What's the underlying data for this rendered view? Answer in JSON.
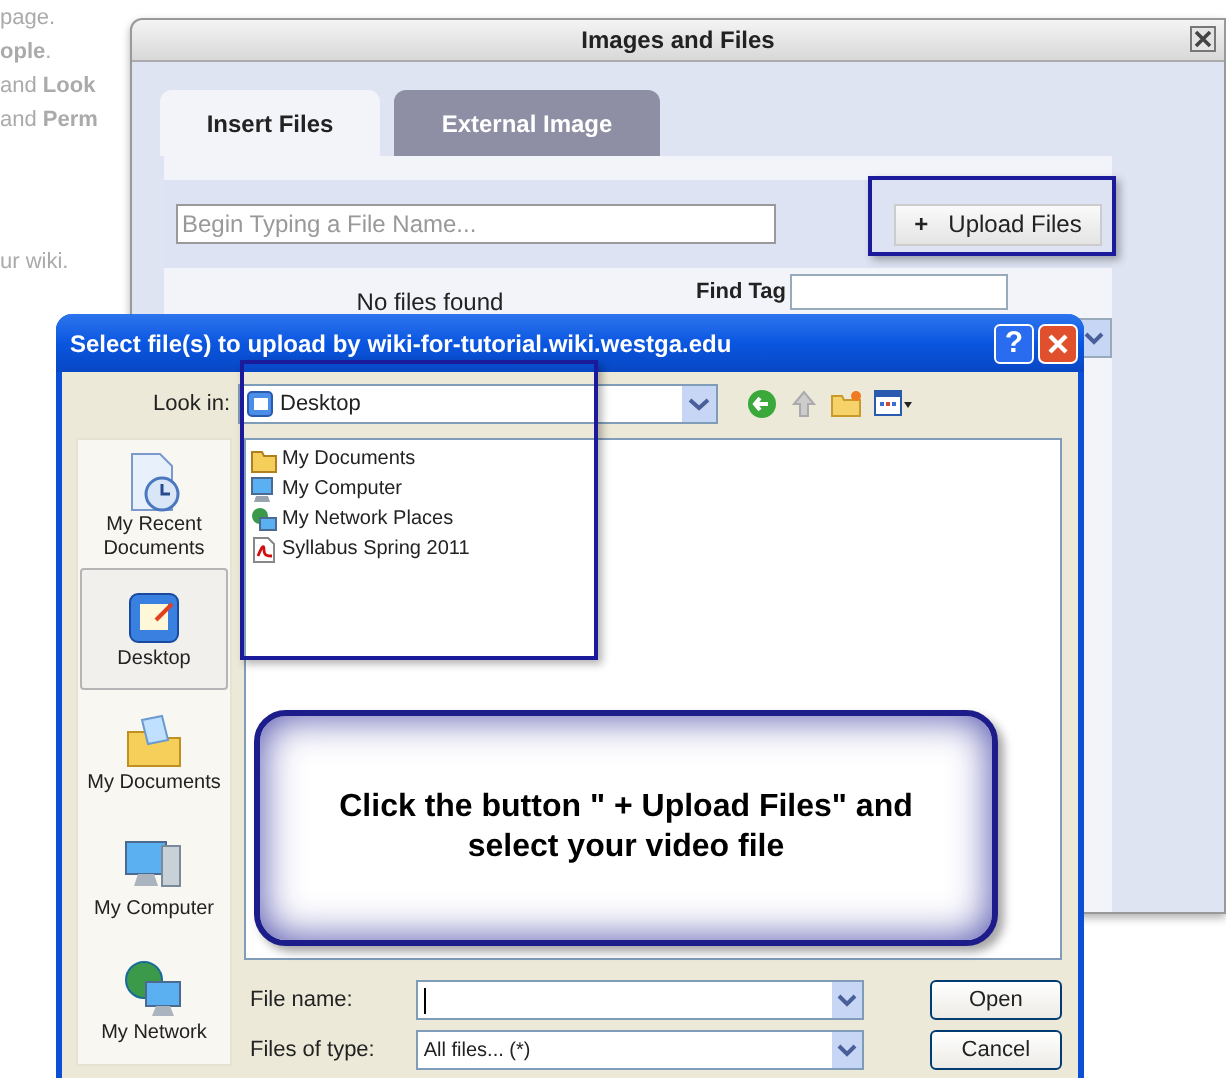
{
  "background_page": {
    "lines": [
      "page.",
      "**ople**.",
      "and **Look**",
      "and **Perm**",
      "ur wiki."
    ]
  },
  "images_dialog": {
    "title": "Images and Files",
    "tabs": [
      {
        "label": "Insert Files",
        "selected": true
      },
      {
        "label": "External Image",
        "selected": false
      }
    ],
    "search": {
      "placeholder": "Begin Typing a File Name..."
    },
    "upload_button": {
      "icon": "+",
      "label": "Upload Files"
    },
    "empty_message": "No files found",
    "find_tag_label": "Find Tag"
  },
  "file_dialog": {
    "title": "Select file(s) to upload by wiki-for-tutorial.wiki.westga.edu",
    "help_button": "?",
    "look_in_label": "Look in:",
    "look_in_value": "Desktop",
    "places": [
      {
        "label": "My Recent Documents",
        "kind": "recent",
        "selected": false
      },
      {
        "label": "Desktop",
        "kind": "desktop",
        "selected": true
      },
      {
        "label": "My Documents",
        "kind": "documents",
        "selected": false
      },
      {
        "label": "My Computer",
        "kind": "computer",
        "selected": false
      },
      {
        "label": "My Network",
        "kind": "network",
        "selected": false
      }
    ],
    "files": [
      {
        "name": "My Documents",
        "kind": "folder"
      },
      {
        "name": "My Computer",
        "kind": "computer"
      },
      {
        "name": "My Network Places",
        "kind": "network"
      },
      {
        "name": "Syllabus Spring 2011",
        "kind": "pdf"
      }
    ],
    "file_name_label": "File name:",
    "file_type_label": "Files of type:",
    "file_type_value": "All files... (*)",
    "buttons": [
      "Open",
      "Cancel"
    ]
  },
  "callout": "Click the button \" + Upload Files\" and select your video file"
}
